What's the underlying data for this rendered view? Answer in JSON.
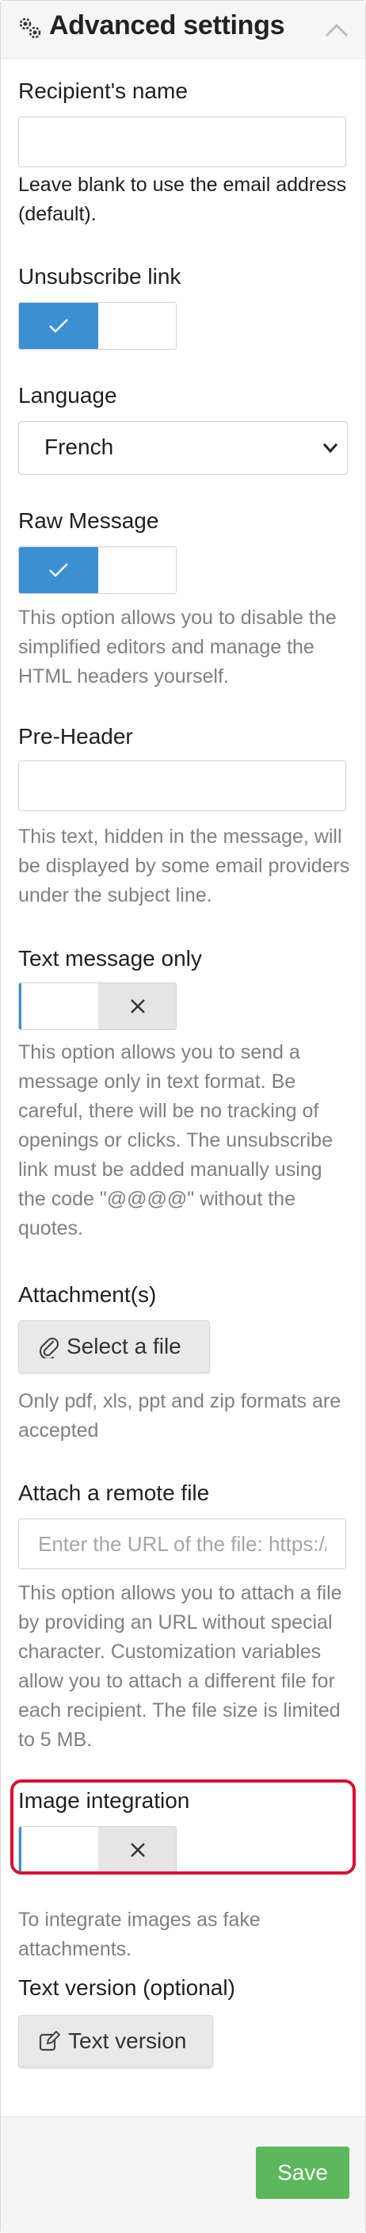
{
  "header": {
    "title": "Advanced settings",
    "icon": "gears-icon",
    "collapse_icon": "chevron-up-icon"
  },
  "fields": {
    "recipient_name": {
      "label": "Recipient's name",
      "value": "",
      "help": "Leave blank to use the email address (default)."
    },
    "unsubscribe_link": {
      "label": "Unsubscribe link",
      "enabled": true
    },
    "language": {
      "label": "Language",
      "selected": "French"
    },
    "raw_message": {
      "label": "Raw Message",
      "enabled": true,
      "help": "This option allows you to disable the simplified editors and manage the HTML headers yourself."
    },
    "pre_header": {
      "label": "Pre-Header",
      "value": "",
      "help": "This text, hidden in the message, will be displayed by some email providers under the subject line."
    },
    "text_message_only": {
      "label": "Text message only",
      "enabled": false,
      "help": "This option allows you to send a message only in text format. Be careful, there will be no tracking of openings or clicks. The unsubscribe link must be added manually using the code \"@@@@\" without the quotes."
    },
    "attachments": {
      "label": "Attachment(s)",
      "button_label": "Select a file",
      "help": "Only pdf, xls, ppt and zip formats are accepted"
    },
    "remote_file": {
      "label": "Attach a remote file",
      "placeholder": "Enter the URL of the file: https://",
      "value": "",
      "help": "This option allows you to attach a file by providing an URL without special character. Customization variables allow you to attach a different file for each recipient. The file size is limited to 5 MB."
    },
    "image_integration": {
      "label": "Image integration",
      "enabled": false,
      "help": "To integrate images as fake attachments."
    },
    "text_version": {
      "label": "Text version (optional)",
      "button_label": "Text version"
    }
  },
  "footer": {
    "save_label": "Save"
  },
  "colors": {
    "toggle_on": "#3d8fd4",
    "toggle_off": "#e5e5e5",
    "save": "#5cb85c",
    "highlight": "#d7102f"
  }
}
